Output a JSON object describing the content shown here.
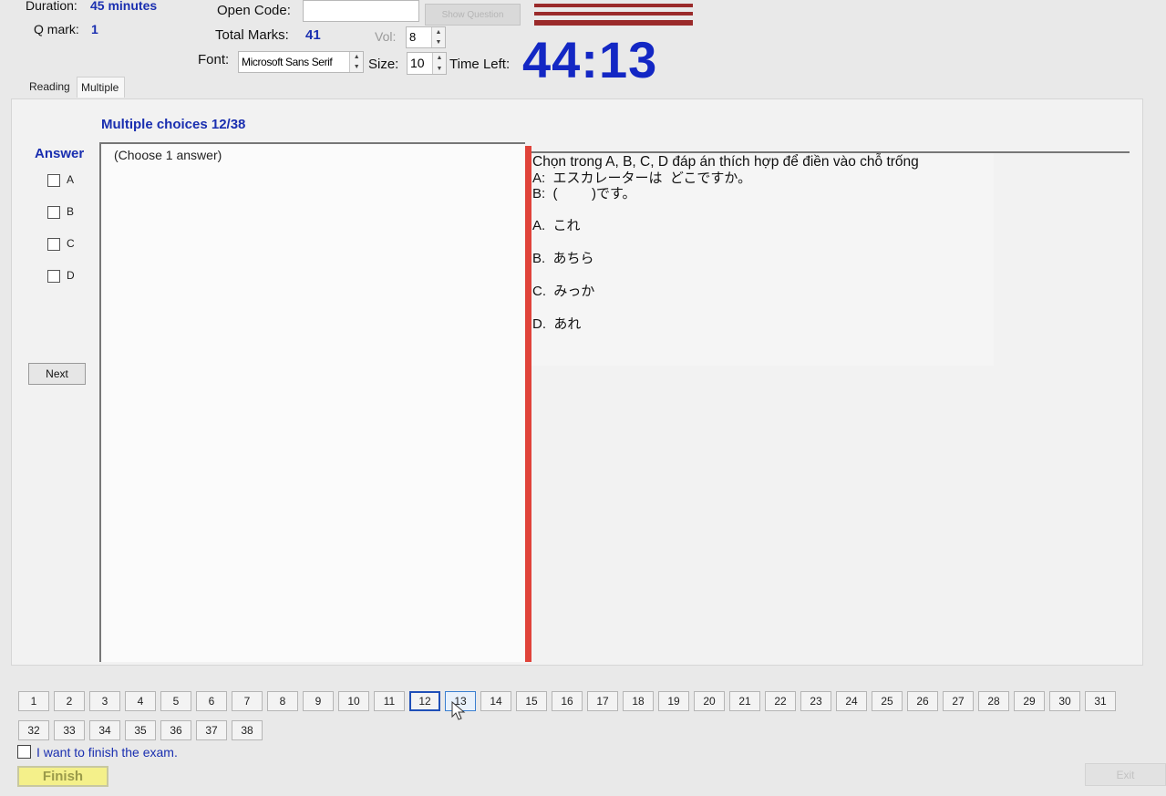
{
  "header": {
    "duration_label": "Duration:",
    "duration_value": "45 minutes",
    "qmark_label": "Q mark:",
    "qmark_value": "1",
    "open_code_label": "Open Code:",
    "open_code_value": "",
    "show_question_label": "Show Question",
    "total_marks_label": "Total Marks:",
    "total_marks_value": "41",
    "vol_label": "Vol:",
    "vol_value": "8",
    "font_label": "Font:",
    "font_value": "Microsoft Sans Serif",
    "size_label": "Size:",
    "size_value": "10",
    "time_left_label": "Time Left:",
    "time_left_value": "44:13"
  },
  "tabs": [
    {
      "label": "Reading",
      "active": false
    },
    {
      "label": "Multiple Choices",
      "active": true
    }
  ],
  "main": {
    "section_title": "Multiple choices 12/38",
    "answer_heading": "Answer",
    "answers": [
      "A",
      "B",
      "C",
      "D"
    ],
    "choose_hint": "(Choose 1 answer)",
    "next_label": "Next",
    "question": {
      "instruction": "Chọn trong A, B, C, D đáp án thích hợp để điền vào chỗ trống",
      "line_a": "A:  エスカレーターは  どこですか。",
      "line_b": "B:  (         )です。",
      "options": [
        "A.  これ",
        "B.  あちら",
        "C.  みっか",
        "D.  あれ"
      ]
    }
  },
  "navigator": {
    "questions": [
      "1",
      "2",
      "3",
      "4",
      "5",
      "6",
      "7",
      "8",
      "9",
      "10",
      "11",
      "12",
      "13",
      "14",
      "15",
      "16",
      "17",
      "18",
      "19",
      "20",
      "21",
      "22",
      "23",
      "24",
      "25",
      "26",
      "27",
      "28",
      "29",
      "30",
      "31",
      "32",
      "33",
      "34",
      "35",
      "36",
      "37",
      "38"
    ],
    "current": "12",
    "hovered": "13"
  },
  "footer": {
    "finish_checkbox_label": "I want to finish the exam.",
    "finish_label": "Finish",
    "exit_label": "Exit"
  },
  "colors": {
    "accent_blue": "#1a2fb0",
    "timer_blue": "#1327c4",
    "divider_red": "#e0433a",
    "finish_yellow": "#f4f08a"
  }
}
